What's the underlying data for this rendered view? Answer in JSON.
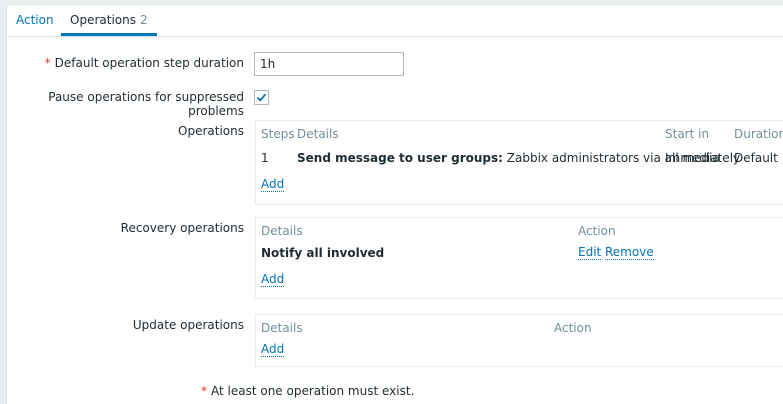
{
  "tabs": [
    {
      "label": "Action"
    },
    {
      "label": "Operations",
      "count": "2"
    }
  ],
  "form": {
    "step_duration_label": "Default operation step duration",
    "step_duration_value": "1h",
    "pause_label": "Pause operations for suppressed problems",
    "pause_checked": true,
    "operations_label": "Operations",
    "recovery_label": "Recovery operations",
    "update_label": "Update operations",
    "required_marker": "*",
    "note": "At least one operation must exist."
  },
  "operations": {
    "headers": {
      "steps": "Steps",
      "details": "Details",
      "start_in": "Start in",
      "duration": "Duration"
    },
    "rows": [
      {
        "steps": "1",
        "details_bold": "Send message to user groups:",
        "details_text": "Zabbix administrators via all media",
        "start_in": "Immediately",
        "duration": "Default"
      }
    ],
    "add_label": "Add"
  },
  "recovery": {
    "headers": {
      "details": "Details",
      "action": "Action"
    },
    "rows": [
      {
        "details": "Notify all involved",
        "edit_label": "Edit",
        "remove_label": "Remove"
      }
    ],
    "add_label": "Add"
  },
  "update": {
    "headers": {
      "details": "Details",
      "action": "Action"
    },
    "add_label": "Add"
  },
  "colors": {
    "accent": "#0275b8",
    "required": "#e33734",
    "muted": "#768d99"
  }
}
